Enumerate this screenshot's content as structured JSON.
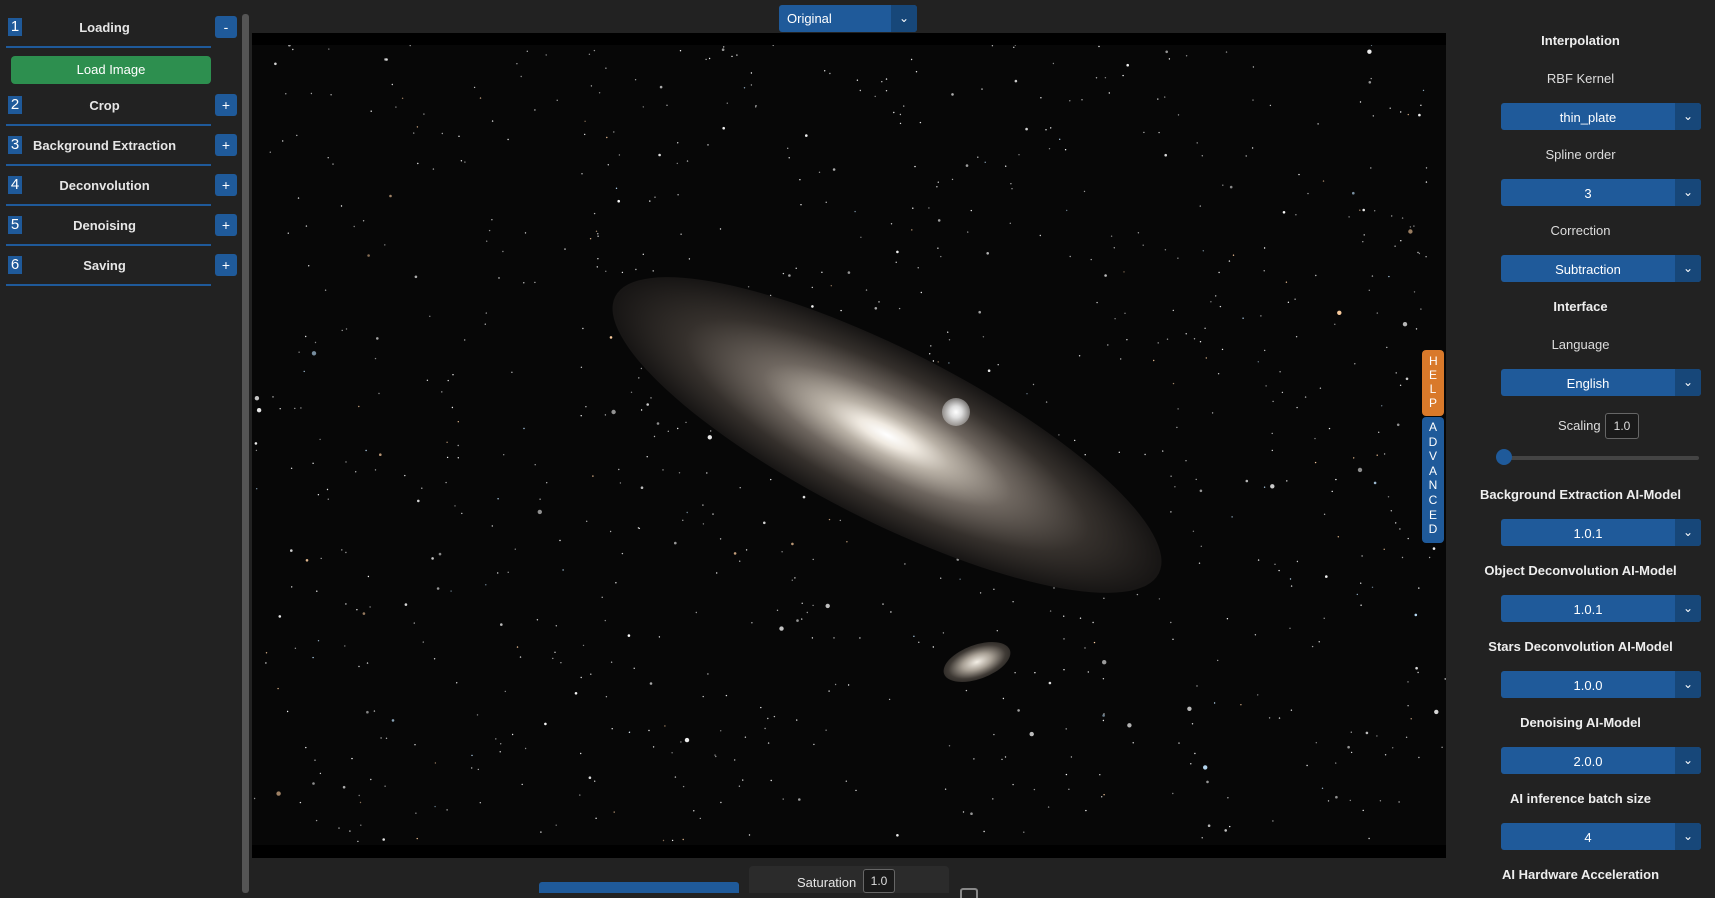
{
  "steps": [
    {
      "num": "1",
      "title": "Loading",
      "toggle": "-"
    },
    {
      "num": "2",
      "title": "Crop",
      "toggle": "+"
    },
    {
      "num": "3",
      "title": "Background Extraction",
      "toggle": "+"
    },
    {
      "num": "4",
      "title": "Deconvolution",
      "toggle": "+"
    },
    {
      "num": "5",
      "title": "Denoising",
      "toggle": "+"
    },
    {
      "num": "6",
      "title": "Saving",
      "toggle": "+"
    }
  ],
  "loading": {
    "load_button": "Load Image"
  },
  "viewer": {
    "view_select": "Original",
    "help_tab": "HELP",
    "advanced_tab": "ADVANCED"
  },
  "bottom": {
    "saturation_label": "Saturation",
    "saturation_value": "1.0"
  },
  "settings": {
    "interpolation_heading": "Interpolation",
    "rbf_kernel_label": "RBF Kernel",
    "rbf_kernel_value": "thin_plate",
    "spline_order_label": "Spline order",
    "spline_order_value": "3",
    "correction_label": "Correction",
    "correction_value": "Subtraction",
    "interface_heading": "Interface",
    "language_label": "Language",
    "language_value": "English",
    "scaling_label": "Scaling",
    "scaling_value": "1.0",
    "bg_model_label": "Background Extraction AI-Model",
    "bg_model_value": "1.0.1",
    "obj_deconv_label": "Object Deconvolution AI-Model",
    "obj_deconv_value": "1.0.1",
    "stars_deconv_label": "Stars Deconvolution AI-Model",
    "stars_deconv_value": "1.0.0",
    "denoise_model_label": "Denoising AI-Model",
    "denoise_model_value": "2.0.0",
    "batch_label": "AI inference batch size",
    "batch_value": "4",
    "hw_accel_label": "AI Hardware Acceleration"
  },
  "colors": {
    "accent": "#1f5a9a",
    "load_green": "#2d8f4f",
    "help_orange": "#d9792a",
    "background": "#222222"
  },
  "icons": {
    "dropdown": "chevron-down-icon"
  }
}
